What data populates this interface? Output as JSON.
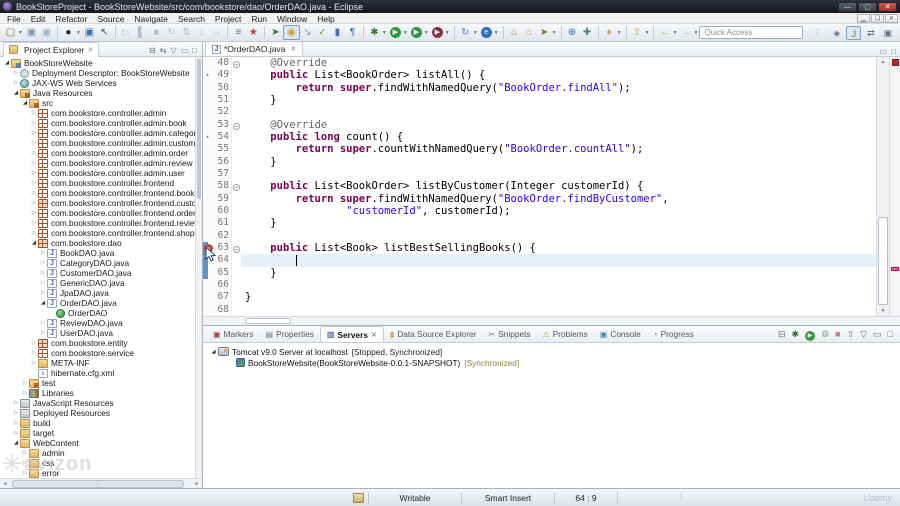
{
  "window": {
    "title": "BookStoreProject - BookStoreWebsite/src/com/bookstore/dao/OrderDAO.java - Eclipse",
    "controls": {
      "minimize": "—",
      "maximize": "▢",
      "close": "✕"
    }
  },
  "menu": {
    "items": [
      "File",
      "Edit",
      "Refactor",
      "Source",
      "Navigate",
      "Search",
      "Project",
      "Run",
      "Window",
      "Help"
    ]
  },
  "toolbar": {
    "quick_access": "Quick Access",
    "icons": [
      {
        "n": "new-wizard",
        "g": "▢",
        "c": "#8a6d2f",
        "drop": true
      },
      {
        "n": "save",
        "g": "▣",
        "c": "#7d97b5"
      },
      {
        "n": "save-all",
        "g": "▣",
        "c": "#a5b7cc"
      },
      {
        "sep": true
      },
      {
        "n": "run-last-tool",
        "g": "●",
        "c": "#1f1f1f",
        "drop": true
      },
      {
        "n": "open-web-browser",
        "g": "▣",
        "c": "#2f6fbd"
      },
      {
        "n": "selection-pointer",
        "g": "↖",
        "c": "#444a55"
      },
      {
        "sep": true
      },
      {
        "n": "skip-breakpoints",
        "g": "▷",
        "c": "#b9bfc7"
      },
      {
        "n": "suspend",
        "g": "▌",
        "c": "#b9bfc7"
      },
      {
        "n": "terminate",
        "g": "■",
        "c": "#b9bfc7"
      },
      {
        "n": "relaunch",
        "g": "↻",
        "c": "#b9bfc7"
      },
      {
        "n": "disconnect",
        "g": "⇅",
        "c": "#b9bfc7"
      },
      {
        "n": "step-into",
        "g": "↓",
        "c": "#b9bfc7"
      },
      {
        "n": "step-over",
        "g": "→",
        "c": "#b9bfc7"
      },
      {
        "sep": true
      },
      {
        "n": "show-view",
        "g": "≡",
        "c": "#67707c"
      },
      {
        "n": "external-tools",
        "g": "★",
        "c": "#b5432e"
      },
      {
        "sep": true
      },
      {
        "n": "pin-editor",
        "g": "➤",
        "c": "#3c6e2f"
      },
      {
        "n": "mark-occurrences",
        "g": "◉",
        "c": "#d4a017",
        "hl": true
      },
      {
        "n": "next-annotation",
        "g": "↘",
        "c": "#8a93a0"
      },
      {
        "n": "task-tags",
        "g": "✓",
        "c": "#7a8f3c"
      },
      {
        "n": "junit",
        "g": "▮",
        "c": "#4a69bd"
      },
      {
        "n": "show-whitespace",
        "g": "¶",
        "c": "#2f6fbd"
      },
      {
        "sep": true
      },
      {
        "n": "debug",
        "g": "✱",
        "c": "#3c6e2f",
        "drop": true
      },
      {
        "n": "run",
        "g": "▶",
        "c": "#2e9b3f",
        "circle": true,
        "drop": true
      },
      {
        "n": "coverage",
        "g": "▶",
        "c": "#2e9b3f",
        "circle": true,
        "drop": true
      },
      {
        "n": "profile",
        "g": "▶",
        "c": "#8b2e3f",
        "circle": true,
        "drop": true
      },
      {
        "sep": true
      },
      {
        "n": "new-server",
        "g": "↻",
        "c": "#4a7fc1",
        "drop": true
      },
      {
        "n": "internet-browser",
        "g": "e",
        "c": "#2f6fbd",
        "circle": true,
        "drop": true
      },
      {
        "sep": true
      },
      {
        "n": "open-resource",
        "g": "⌂",
        "c": "#b08d2f"
      },
      {
        "n": "open-project",
        "g": "⌂",
        "c": "#c8a45a"
      },
      {
        "n": "search",
        "g": "➤",
        "c": "#8a6d2f",
        "drop": true
      },
      {
        "sep": true
      },
      {
        "n": "web-globe",
        "g": "⊕",
        "c": "#2f6fbd"
      },
      {
        "n": "plugin",
        "g": "✚",
        "c": "#3f8f6f"
      },
      {
        "sep": true
      },
      {
        "n": "pin-location",
        "g": "♦",
        "c": "#c8a45a",
        "drop": true
      },
      {
        "sep": true
      },
      {
        "n": "last-edit-location",
        "g": "⇧",
        "c": "#c8a45a",
        "drop": true
      },
      {
        "sep": true
      },
      {
        "n": "back-history",
        "g": "←",
        "c": "#c8a45a",
        "drop": true
      },
      {
        "n": "forward-history",
        "g": "→",
        "c": "#b9bfc7",
        "drop": true
      }
    ],
    "perspectives": [
      {
        "n": "open-perspective",
        "g": "◈",
        "c": "#67707c",
        "active": false
      },
      {
        "n": "java-ee-perspective",
        "g": "J",
        "c": "#8a6d2f",
        "active": true
      },
      {
        "n": "resource-perspective",
        "g": "⇄",
        "c": "#67707c",
        "active": false
      },
      {
        "n": "debug-perspective",
        "g": "▣",
        "c": "#67707c",
        "active": false
      },
      {
        "n": "sync-perspective",
        "g": "✚",
        "c": "#3f8f6f",
        "active": false
      }
    ]
  },
  "explorer": {
    "title": "Project Explorer",
    "toolbar": [
      {
        "n": "collapse-all",
        "g": "⊟"
      },
      {
        "n": "link-with-editor",
        "g": "⇆"
      },
      {
        "n": "view-menu",
        "g": "▽"
      },
      {
        "n": "minimize-view",
        "g": "▭"
      },
      {
        "n": "maximize-view",
        "g": "□"
      }
    ],
    "tree": [
      {
        "l": 0,
        "a": "e",
        "i": "proj",
        "t": "BookStoreWebsite"
      },
      {
        "l": 1,
        "a": "c",
        "i": "depl",
        "t": "Deployment Descriptor: BookStoreWebsite"
      },
      {
        "l": 1,
        "a": "c",
        "i": "jaxws",
        "t": "JAX-WS Web Services"
      },
      {
        "l": 1,
        "a": "e",
        "i": "jres",
        "t": "Java Resources"
      },
      {
        "l": 2,
        "a": "e",
        "i": "srcf",
        "t": "src"
      },
      {
        "l": 3,
        "a": "c",
        "i": "pkg",
        "t": "com.bookstore.controller.admin"
      },
      {
        "l": 3,
        "a": "c",
        "i": "pkg",
        "t": "com.bookstore.controller.admin.book"
      },
      {
        "l": 3,
        "a": "c",
        "i": "pkg",
        "t": "com.bookstore.controller.admin.category"
      },
      {
        "l": 3,
        "a": "c",
        "i": "pkg",
        "t": "com.bookstore.controller.admin.customer"
      },
      {
        "l": 3,
        "a": "c",
        "i": "pkg",
        "t": "com.bookstore.controller.admin.order"
      },
      {
        "l": 3,
        "a": "c",
        "i": "pkg",
        "t": "com.bookstore.controller.admin.review"
      },
      {
        "l": 3,
        "a": "c",
        "i": "pkg",
        "t": "com.bookstore.controller.admin.user"
      },
      {
        "l": 3,
        "a": "c",
        "i": "pkg",
        "t": "com.bookstore.controller.frontend"
      },
      {
        "l": 3,
        "a": "c",
        "i": "pkg",
        "t": "com.bookstore.controller.frontend.book"
      },
      {
        "l": 3,
        "a": "c",
        "i": "pkg2",
        "t": "com.bookstore.controller.frontend.customer"
      },
      {
        "l": 3,
        "a": "c",
        "i": "pkg",
        "t": "com.bookstore.controller.frontend.order"
      },
      {
        "l": 3,
        "a": "c",
        "i": "pkg",
        "t": "com.bookstore.controller.frontend.review"
      },
      {
        "l": 3,
        "a": "c",
        "i": "pkg",
        "t": "com.bookstore.controller.frontend.shoppingca"
      },
      {
        "l": 3,
        "a": "e",
        "i": "pkg2",
        "t": "com.bookstore.dao"
      },
      {
        "l": 4,
        "a": "c",
        "i": "jfile",
        "t": "BookDAO.java"
      },
      {
        "l": 4,
        "a": "c",
        "i": "jfile",
        "t": "CategoryDAO.java"
      },
      {
        "l": 4,
        "a": "c",
        "i": "jfile",
        "t": "CustomerDAO.java"
      },
      {
        "l": 4,
        "a": "c",
        "i": "jfile",
        "t": "GenericDAO.java"
      },
      {
        "l": 4,
        "a": "c",
        "i": "jfile",
        "t": "JpaDAO.java"
      },
      {
        "l": 4,
        "a": "e",
        "i": "jfile",
        "t": "OrderDAO.java"
      },
      {
        "l": 5,
        "a": null,
        "i": "cls",
        "t": "OrderDAO"
      },
      {
        "l": 4,
        "a": "c",
        "i": "jfile",
        "t": "ReviewDAO.java"
      },
      {
        "l": 4,
        "a": "c",
        "i": "jfile",
        "t": "UserDAO.java"
      },
      {
        "l": 3,
        "a": "c",
        "i": "pkg2",
        "t": "com.bookstore.entity"
      },
      {
        "l": 3,
        "a": "c",
        "i": "pkg",
        "t": "com.bookstore.service"
      },
      {
        "l": 3,
        "a": "c",
        "i": "fold",
        "t": "META-INF"
      },
      {
        "l": 3,
        "a": null,
        "i": "xml",
        "t": "hibernate.cfg.xml"
      },
      {
        "l": 2,
        "a": "c",
        "i": "srcf",
        "t": "test"
      },
      {
        "l": 2,
        "a": "c",
        "i": "lib",
        "t": "Libraries"
      },
      {
        "l": 1,
        "a": "c",
        "i": "jsres",
        "t": "JavaScript Resources"
      },
      {
        "l": 1,
        "a": "c",
        "i": "depr",
        "t": "Deployed Resources"
      },
      {
        "l": 1,
        "a": "c",
        "i": "fold",
        "t": "build"
      },
      {
        "l": 1,
        "a": "c",
        "i": "fold",
        "t": "target"
      },
      {
        "l": 1,
        "a": "e",
        "i": "fold",
        "t": "WebContent"
      },
      {
        "l": 2,
        "a": "c",
        "i": "fold",
        "t": "admin"
      },
      {
        "l": 2,
        "a": "c",
        "i": "fold",
        "t": "css"
      },
      {
        "l": 2,
        "a": "c",
        "i": "fold",
        "t": "error"
      }
    ]
  },
  "editor": {
    "tab": "*OrderDAO.java",
    "tab_close": "✕",
    "lines": [
      {
        "n": "48",
        "f": true,
        "seg": [
          [
            "a",
            "    @Override"
          ]
        ]
      },
      {
        "n": "49",
        "o": true,
        "seg": [
          [
            "k",
            "    public"
          ],
          [
            "p",
            " List<BookOrder> listAll() {"
          ]
        ]
      },
      {
        "n": "50",
        "seg": [
          [
            "p",
            "        "
          ],
          [
            "k",
            "return"
          ],
          [
            "p",
            " "
          ],
          [
            "k",
            "super"
          ],
          [
            "p",
            ".findWithNamedQuery("
          ],
          [
            "s",
            "\"BookOrder.findAll\""
          ],
          [
            "p",
            ");"
          ]
        ]
      },
      {
        "n": "51",
        "seg": [
          [
            "p",
            "    }"
          ]
        ]
      },
      {
        "n": "52",
        "seg": []
      },
      {
        "n": "53",
        "f": true,
        "seg": [
          [
            "a",
            "    @Override"
          ]
        ]
      },
      {
        "n": "54",
        "o": true,
        "seg": [
          [
            "p",
            "    "
          ],
          [
            "k",
            "public"
          ],
          [
            "p",
            " "
          ],
          [
            "k",
            "long"
          ],
          [
            "p",
            " count() {"
          ]
        ]
      },
      {
        "n": "55",
        "seg": [
          [
            "p",
            "        "
          ],
          [
            "k",
            "return"
          ],
          [
            "p",
            " "
          ],
          [
            "k",
            "super"
          ],
          [
            "p",
            ".countWithNamedQuery("
          ],
          [
            "s",
            "\"BookOrder.countAll\""
          ],
          [
            "p",
            ");"
          ]
        ]
      },
      {
        "n": "56",
        "seg": [
          [
            "p",
            "    }"
          ]
        ]
      },
      {
        "n": "57",
        "seg": []
      },
      {
        "n": "58",
        "f": true,
        "seg": [
          [
            "p",
            "    "
          ],
          [
            "k",
            "public"
          ],
          [
            "p",
            " List<BookOrder> listByCustomer(Integer customerId) {"
          ]
        ]
      },
      {
        "n": "59",
        "seg": [
          [
            "p",
            "        "
          ],
          [
            "k",
            "return"
          ],
          [
            "p",
            " "
          ],
          [
            "k",
            "super"
          ],
          [
            "p",
            ".findWithNamedQuery("
          ],
          [
            "s",
            "\"BookOrder.findByCustomer\""
          ],
          [
            "p",
            ","
          ]
        ]
      },
      {
        "n": "60",
        "seg": [
          [
            "p",
            "                "
          ],
          [
            "s",
            "\"customerId\""
          ],
          [
            "p",
            ", customerId);"
          ]
        ]
      },
      {
        "n": "61",
        "seg": [
          [
            "p",
            "    }"
          ]
        ]
      },
      {
        "n": "62",
        "seg": []
      },
      {
        "n": "63",
        "f": true,
        "err": true,
        "seg": [
          [
            "p",
            "    "
          ],
          [
            "k",
            "public"
          ],
          [
            "p",
            " List<"
          ],
          [
            "e",
            "Book"
          ],
          [
            "p",
            "> "
          ],
          [
            "e",
            "listBestSellingBooks"
          ],
          [
            "p",
            "() {"
          ]
        ]
      },
      {
        "n": "64",
        "cur": true,
        "seg": [
          [
            "p",
            "        "
          ],
          [
            "c",
            ""
          ]
        ]
      },
      {
        "n": "65",
        "seg": [
          [
            "p",
            "    }"
          ]
        ]
      },
      {
        "n": "66",
        "seg": []
      },
      {
        "n": "67",
        "seg": [
          [
            "p",
            "}"
          ]
        ]
      },
      {
        "n": "68",
        "seg": []
      }
    ]
  },
  "views": {
    "tabs": [
      {
        "label": "Markers",
        "icon": "markers",
        "g": "▣",
        "c": "#a04040",
        "active": false
      },
      {
        "label": "Properties",
        "icon": "properties",
        "g": "▤",
        "c": "#6e7685",
        "active": false
      },
      {
        "label": "Servers",
        "icon": "servers",
        "g": "▥",
        "c": "#5d7ba2",
        "active": true
      },
      {
        "label": "Data Source Explorer",
        "icon": "data-source",
        "g": "▮",
        "c": "#caa85a",
        "active": false
      },
      {
        "label": "Snippets",
        "icon": "snippets",
        "g": "✂",
        "c": "#6e7685",
        "active": false
      },
      {
        "label": "Problems",
        "icon": "problems",
        "g": "⚠",
        "c": "#caa85a",
        "active": false
      },
      {
        "label": "Console",
        "icon": "console",
        "g": "▣",
        "c": "#4a7fc1",
        "active": false
      },
      {
        "label": "Progress",
        "icon": "progress",
        "g": "◔",
        "c": "#6e7685",
        "active": false
      }
    ],
    "toolbar": [
      {
        "n": "collapse-all",
        "g": "⊟",
        "c": "#67707c"
      },
      {
        "n": "debug-server",
        "g": "✱",
        "c": "#3c6e2f"
      },
      {
        "n": "start-server",
        "g": "▶",
        "c": "#2e9b3f",
        "circle": true
      },
      {
        "n": "profile-server",
        "g": "⚙",
        "c": "#8a93a0"
      },
      {
        "n": "stop-server",
        "g": "■",
        "c": "#c08080"
      },
      {
        "n": "publish-server",
        "g": "⇧",
        "c": "#6e7685"
      },
      {
        "n": "view-menu",
        "g": "▽",
        "c": "#67707c"
      },
      {
        "n": "minimize-view",
        "g": "▭",
        "c": "#67707c"
      },
      {
        "n": "maximize-view",
        "g": "□",
        "c": "#67707c"
      }
    ],
    "servers": [
      {
        "arrow": "e",
        "icon": "tomcat",
        "label": "Tomcat v9.0 Server at localhost",
        "state": "[Stopped, Synchronized]",
        "state_style": "dark"
      },
      {
        "arrow": null,
        "icon": "webapp",
        "label": "BookStoreWebsite(BookStoreWebsite-0.0.1-SNAPSHOT)",
        "state": "[Synchronized]",
        "state_style": "olive"
      }
    ]
  },
  "status": {
    "writable": "Writable",
    "input_mode": "Smart Insert",
    "cursor_position": "64 : 9"
  },
  "watermarks": {
    "bottom_left": "avizon",
    "bottom_right": "Udemy"
  }
}
